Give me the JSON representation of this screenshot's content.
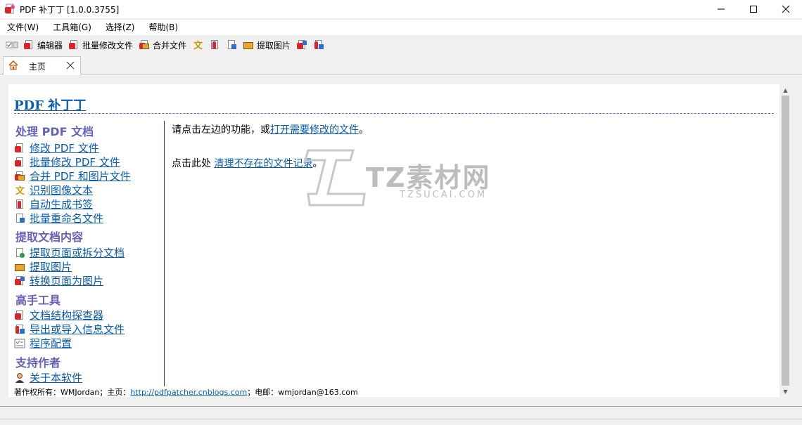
{
  "window": {
    "title": "PDF 补丁丁 [1.0.0.3755]",
    "minimize_glyph": "—",
    "maximize_glyph": "☐",
    "close_glyph": "✕"
  },
  "menu": [
    "文件(W)",
    "工具箱(G)",
    "选择(Z)",
    "帮助(B)"
  ],
  "toolbar": {
    "editor": "编辑器",
    "batch_modify": "批量修改文件",
    "merge": "合并文件",
    "extract_images": "提取图片"
  },
  "tab": {
    "label": "主页",
    "close_glyph": "×"
  },
  "page": {
    "title": "PDF 补丁丁",
    "instruction_prefix": "请点击左边的功能，或",
    "instruction_link": "打开需要修改的文件",
    "instruction_suffix": "。",
    "clean_prefix": "点击此处 ",
    "clean_link": "清理不存在的文件记录",
    "clean_suffix": "。"
  },
  "sidebar": {
    "sections": [
      {
        "title": "处理 PDF 文档",
        "items": [
          "修改 PDF 文件",
          "批量修改 PDF 文件",
          "合并 PDF 和图片文件",
          "识别图像文本",
          "自动生成书签",
          "批量重命名文件"
        ]
      },
      {
        "title": "提取文档内容",
        "items": [
          "提取页面或拆分文档",
          "提取图片",
          "转换页面为图片"
        ]
      },
      {
        "title": "高手工具",
        "items": [
          "文档结构探查器",
          "导出或导入信息文件",
          "程序配置"
        ]
      },
      {
        "title": "支持作者",
        "items": [
          "关于本软件"
        ]
      }
    ]
  },
  "footer": {
    "copyright": "著作权所有：WMJordan；主页：",
    "homepage": "http://pdfpatcher.cnblogs.com",
    "email_label": "；电邮：wmjordan@163.com"
  },
  "watermark": {
    "brand": "TZ素材网",
    "site": "TZSUCAI.COM"
  },
  "scroll": {
    "up_glyph": "▲",
    "down_glyph": "▼"
  }
}
